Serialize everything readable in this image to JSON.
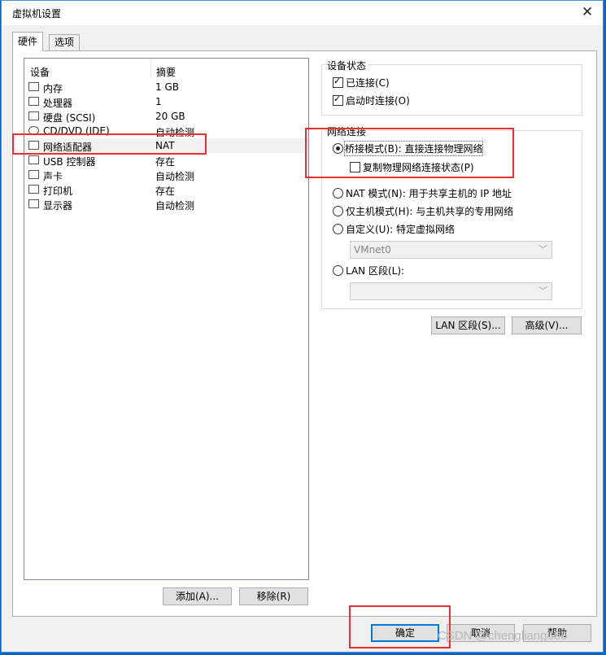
{
  "window": {
    "title": "虚拟机设置",
    "close_glyph": "✕"
  },
  "tabs": [
    {
      "label": "硬件"
    },
    {
      "label": "选项"
    }
  ],
  "device_list": {
    "headers": {
      "device": "设备",
      "summary": "摘要"
    },
    "rows": [
      {
        "name": "内存",
        "summary": "1 GB",
        "icon": "memory-icon"
      },
      {
        "name": "处理器",
        "summary": "1",
        "icon": "processor-icon"
      },
      {
        "name": "硬盘 (SCSI)",
        "summary": "20 GB",
        "icon": "hard-disk-icon"
      },
      {
        "name": "CD/DVD (IDE)",
        "summary": "自动检测",
        "icon": "cd-dvd-icon"
      },
      {
        "name": "网络适配器",
        "summary": "NAT",
        "icon": "network-adapter-icon"
      },
      {
        "name": "USB 控制器",
        "summary": "存在",
        "icon": "usb-icon"
      },
      {
        "name": "声卡",
        "summary": "自动检测",
        "icon": "sound-card-icon"
      },
      {
        "name": "打印机",
        "summary": "存在",
        "icon": "printer-icon"
      },
      {
        "name": "显示器",
        "summary": "自动检测",
        "icon": "display-icon"
      }
    ],
    "add_button": "添加(A)...",
    "remove_button": "移除(R)"
  },
  "device_status": {
    "title": "设备状态",
    "connected": "已连接(C)",
    "connect_at_power_on": "启动时连接(O)"
  },
  "network": {
    "title": "网络连接",
    "bridged": "桥接模式(B): 直接连接物理网络",
    "replicate": "复制物理网络连接状态(P)",
    "nat": "NAT 模式(N): 用于共享主机的 IP 地址",
    "host_only": "仅主机模式(H): 与主机共享的专用网络",
    "custom": "自定义(U): 特定虚拟网络",
    "custom_value": "VMnet0",
    "lan_segment": "LAN 区段(L):",
    "lan_segment_value": ""
  },
  "actions": {
    "lan_segments_button": "LAN 区段(S)...",
    "advanced_button": "高级(V)..."
  },
  "footer": {
    "ok": "确定",
    "cancel": "取消",
    "help": "帮助"
  },
  "watermark": "CSDN @chengliang666",
  "colors": {
    "highlight": "#e8312f",
    "accent": "#0078d7"
  }
}
